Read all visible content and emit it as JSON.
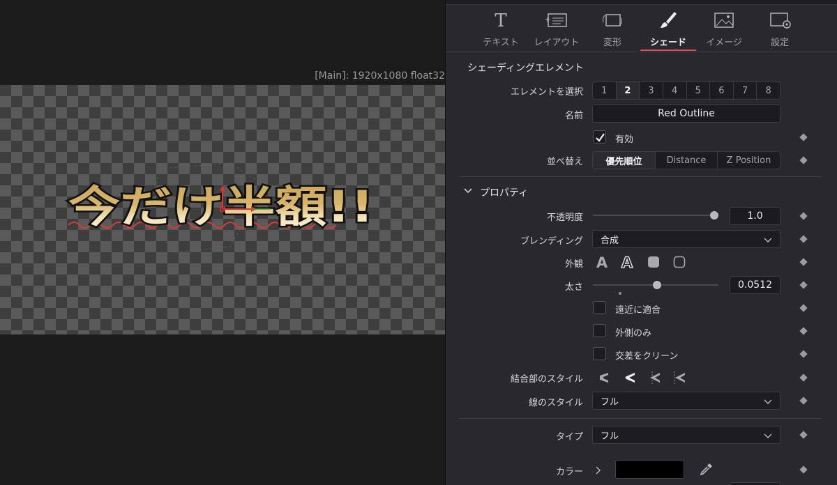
{
  "viewer": {
    "label": "[Main]: 1920x1080 float32",
    "headline": "今だけ半額!!"
  },
  "tabs": [
    {
      "label": "テキスト",
      "icon": "text-icon"
    },
    {
      "label": "レイアウト",
      "icon": "layout-icon"
    },
    {
      "label": "変形",
      "icon": "transform-icon"
    },
    {
      "label": "シェード",
      "icon": "brush-icon"
    },
    {
      "label": "イメージ",
      "icon": "image-icon"
    },
    {
      "label": "設定",
      "icon": "settings-icon"
    }
  ],
  "active_tab": "シェード",
  "accent_color": "#e04a50",
  "shading": {
    "section_title": "シェーディングエレメント",
    "select_label": "エレメントを選択",
    "elements": [
      "1",
      "2",
      "3",
      "4",
      "5",
      "6",
      "7",
      "8"
    ],
    "selected_element": "2",
    "name_label": "名前",
    "name_value": "Red Outline",
    "enabled_label": "有効",
    "enabled": true,
    "sort_label": "並べ替え",
    "sort_options": [
      "優先順位",
      "Distance",
      "Z Position"
    ],
    "sort_selected": "優先順位"
  },
  "properties": {
    "section_title": "プロパティ",
    "opacity_label": "不透明度",
    "opacity_value": "1.0",
    "opacity": 1.0,
    "blending_label": "ブレンディング",
    "blending_value": "合成",
    "appearance_label": "外観",
    "appearance_icons": [
      "text-solid-icon",
      "text-outline-icon",
      "rounded-square-filled-icon",
      "rounded-square-outline-icon"
    ],
    "thickness_label": "太さ",
    "thickness_value": "0.0512",
    "thickness_slider": 0.51,
    "perspective_label": "遠近に適合",
    "outside_only_label": "外側のみ",
    "clean_intersections_label": "交差をクリーン",
    "join_style_label": "結合部のスタイル",
    "join_style_icons": [
      "bevel-join-icon",
      "round-join-icon",
      "miter-join-icon",
      "miter-outline-join-icon"
    ],
    "line_style_label": "線のスタイル",
    "line_style_value": "フル",
    "type_label": "タイプ",
    "type_value": "フル",
    "color_label": "カラー",
    "color_value": "#000000"
  }
}
